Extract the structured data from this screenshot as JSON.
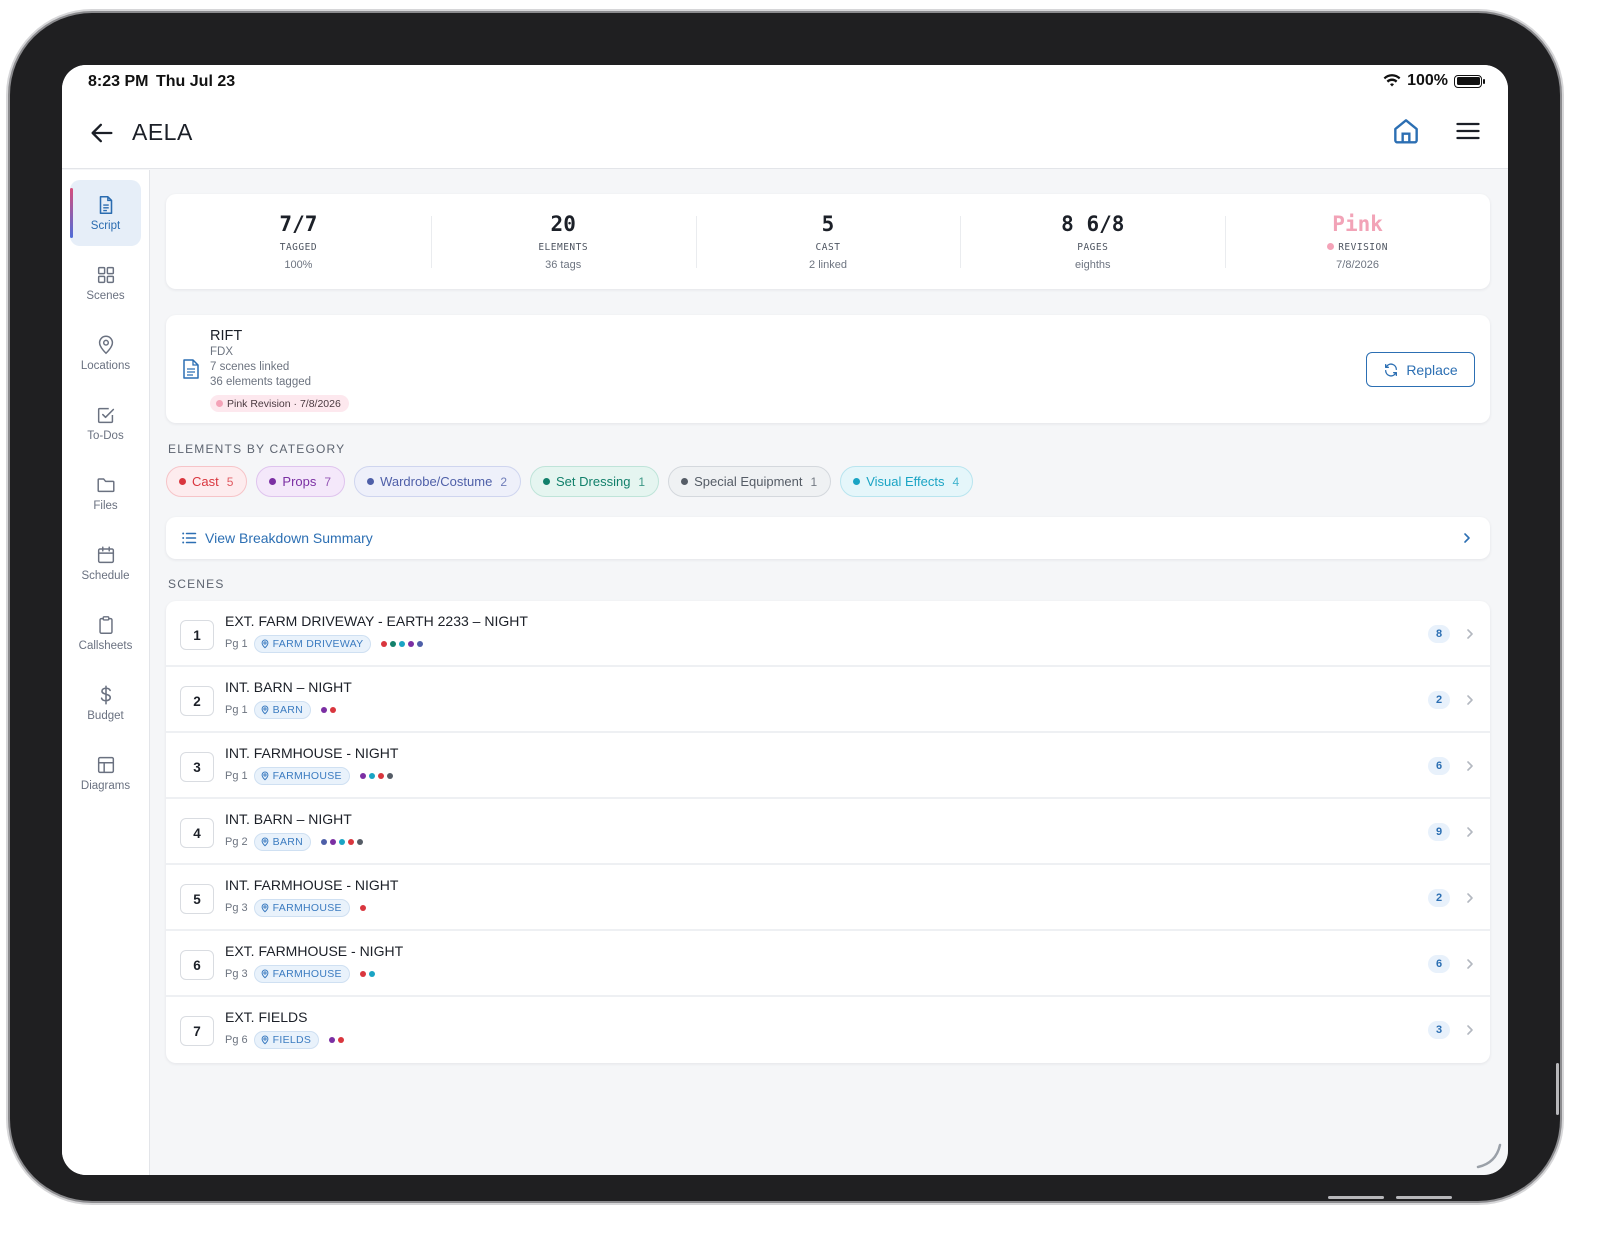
{
  "status": {
    "time": "8:23 PM",
    "date": "Thu Jul 23",
    "battery": "100%"
  },
  "app": {
    "title": "AELA"
  },
  "sidebar": {
    "items": [
      {
        "label": "Script",
        "icon": "document-icon",
        "active": true
      },
      {
        "label": "Scenes",
        "icon": "grid-icon"
      },
      {
        "label": "Locations",
        "icon": "map-pin-icon"
      },
      {
        "label": "To-Dos",
        "icon": "checkbox-icon"
      },
      {
        "label": "Files",
        "icon": "folder-icon"
      },
      {
        "label": "Schedule",
        "icon": "calendar-icon"
      },
      {
        "label": "Callsheets",
        "icon": "clipboard-icon"
      },
      {
        "label": "Budget",
        "icon": "dollar-icon"
      },
      {
        "label": "Diagrams",
        "icon": "layout-icon"
      }
    ]
  },
  "stats": [
    {
      "value": "7/7",
      "label": "TAGGED",
      "sub": "100%"
    },
    {
      "value": "20",
      "label": "ELEMENTS",
      "sub": "36 tags"
    },
    {
      "value": "5",
      "label": "CAST",
      "sub": "2 linked"
    },
    {
      "value": "8 6/8",
      "label": "PAGES",
      "sub": "eighths"
    },
    {
      "value": "Pink",
      "label": "REVISION",
      "sub": "7/8/2026"
    }
  ],
  "script": {
    "title": "RIFT",
    "format": "FDX",
    "scenes_linked": "7 scenes linked",
    "elements_tagged": "36 elements tagged",
    "revision": "Pink Revision · 7/8/2026",
    "replace_label": "Replace"
  },
  "elements_section_label": "ELEMENTS BY CATEGORY",
  "categories": [
    {
      "name": "Cast",
      "count": "5",
      "color": "#d9363e",
      "bg": "#fdecee",
      "border": "#f6c4c8"
    },
    {
      "name": "Props",
      "count": "7",
      "color": "#7b2fa3",
      "bg": "#f4e8fa",
      "border": "#dfc4ee"
    },
    {
      "name": "Wardrobe/Costume",
      "count": "2",
      "color": "#4e5fa8",
      "bg": "#eef0fa",
      "border": "#cfd5ef"
    },
    {
      "name": "Set Dressing",
      "count": "1",
      "color": "#12806b",
      "bg": "#e5f5f0",
      "border": "#bfe4d9"
    },
    {
      "name": "Special Equipment",
      "count": "1",
      "color": "#555c66",
      "bg": "#eff1f3",
      "border": "#d4d8dd"
    },
    {
      "name": "Visual Effects",
      "count": "4",
      "color": "#1aa4c4",
      "bg": "#e5f6fa",
      "border": "#b9e5ef"
    }
  ],
  "breakdown_label": "View Breakdown Summary",
  "scenes_section_label": "SCENES",
  "scenes": [
    {
      "num": "1",
      "title": "EXT. FARM DRIVEWAY - EARTH 2233 – NIGHT",
      "page": "Pg 1",
      "location": "FARM DRIVEWAY",
      "dots": [
        "#d9363e",
        "#12806b",
        "#1aa4c4",
        "#7b2fa3",
        "#4e5fa8"
      ],
      "count": "8"
    },
    {
      "num": "2",
      "title": "INT. BARN – NIGHT",
      "page": "Pg 1",
      "location": "BARN",
      "dots": [
        "#7b2fa3",
        "#d9363e"
      ],
      "count": "2"
    },
    {
      "num": "3",
      "title": "INT. FARMHOUSE - NIGHT",
      "page": "Pg 1",
      "location": "FARMHOUSE",
      "dots": [
        "#7b2fa3",
        "#1aa4c4",
        "#d9363e",
        "#555c66"
      ],
      "count": "6"
    },
    {
      "num": "4",
      "title": "INT. BARN – NIGHT",
      "page": "Pg 2",
      "location": "BARN",
      "dots": [
        "#4e5fa8",
        "#7b2fa3",
        "#1aa4c4",
        "#d9363e",
        "#555c66"
      ],
      "count": "9"
    },
    {
      "num": "5",
      "title": "INT. FARMHOUSE - NIGHT",
      "page": "Pg 3",
      "location": "FARMHOUSE",
      "dots": [
        "#d9363e"
      ],
      "count": "2"
    },
    {
      "num": "6",
      "title": "EXT. FARMHOUSE - NIGHT",
      "page": "Pg 3",
      "location": "FARMHOUSE",
      "dots": [
        "#d9363e",
        "#1aa4c4"
      ],
      "count": "6"
    },
    {
      "num": "7",
      "title": "EXT. FIELDS",
      "page": "Pg 6",
      "location": "FIELDS",
      "dots": [
        "#7b2fa3",
        "#d9363e"
      ],
      "count": "3"
    }
  ]
}
